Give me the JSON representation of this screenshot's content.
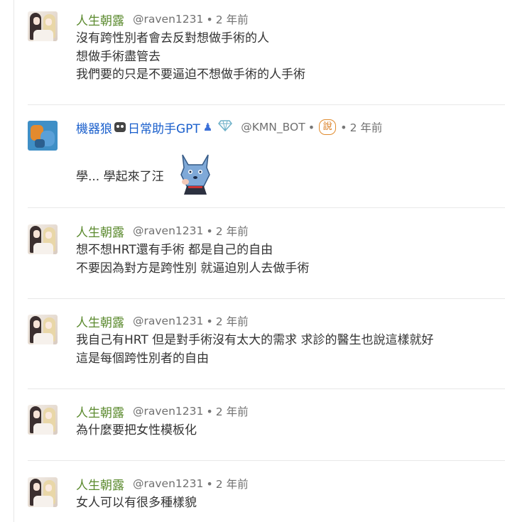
{
  "comments": [
    {
      "name": "人生朝露",
      "handle": "@raven1231",
      "sep": "•",
      "time": "2 年前",
      "lines": [
        "沒有跨性別者會去反對想做手術的人",
        "想做手術盡管去",
        "我們要的只是不要逼迫不想做手術的人手術"
      ]
    },
    {
      "name": "機器狼",
      "name_suffix": "日常助手GPT",
      "handle": "@KMN_BOT",
      "sep": "•",
      "badge": "說",
      "sep2": "•",
      "time": "2 年前",
      "lines": [
        "學... 學起來了汪"
      ],
      "icons": [
        "robot-icon",
        "user-icon",
        "diamond-icon",
        "wolf-sticker"
      ]
    },
    {
      "name": "人生朝露",
      "handle": "@raven1231",
      "sep": "•",
      "time": "2 年前",
      "lines": [
        "想不想HRT還有手術 都是自己的自由",
        "不要因為對方是跨性別 就逼迫別人去做手術"
      ]
    },
    {
      "name": "人生朝露",
      "handle": "@raven1231",
      "sep": "•",
      "time": "2 年前",
      "lines": [
        "我自己有HRT 但是對手術沒有太大的需求 求診的醫生也說這樣就好",
        "這是每個跨性別者的自由"
      ]
    },
    {
      "name": "人生朝露",
      "handle": "@raven1231",
      "sep": "•",
      "time": "2 年前",
      "lines": [
        "為什麼要把女性模板化"
      ]
    },
    {
      "name": "人生朝露",
      "handle": "@raven1231",
      "sep": "•",
      "time": "2 年前",
      "lines": [
        "女人可以有很多種樣貌"
      ]
    }
  ],
  "colors": {
    "name_green": "#5b8a2e",
    "name_blue": "#1a5fcc",
    "meta_gray": "#707070",
    "badge_orange": "#e08a2c"
  }
}
